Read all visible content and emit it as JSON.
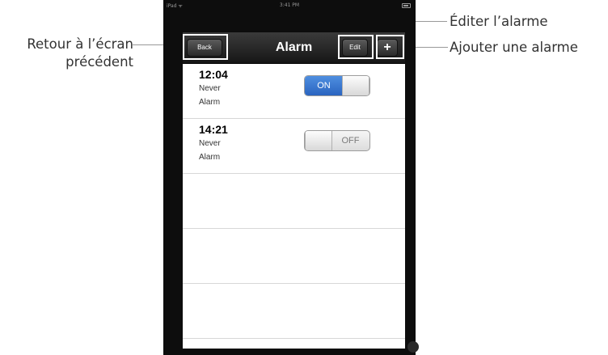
{
  "status_bar": {
    "carrier": "iPad ᯤ",
    "time": "3:41 PM"
  },
  "nav": {
    "title": "Alarm",
    "back_label": "Back",
    "edit_label": "Edit",
    "add_label": "+"
  },
  "alarms": [
    {
      "time": "12:04",
      "repeat": "Never",
      "label": "Alarm",
      "toggle": "ON",
      "enabled": true
    },
    {
      "time": "14:21",
      "repeat": "Never",
      "label": "Alarm",
      "toggle": "OFF",
      "enabled": false
    }
  ],
  "annotations": {
    "back_line1": "Retour à l’écran",
    "back_line2": "précédent",
    "edit": "Éditer l’alarme",
    "add": "Ajouter une alarme"
  },
  "colors": {
    "toggle_on": "#3a78d0",
    "navbar": "#2a2a2a",
    "annotation_text": "#333333"
  }
}
